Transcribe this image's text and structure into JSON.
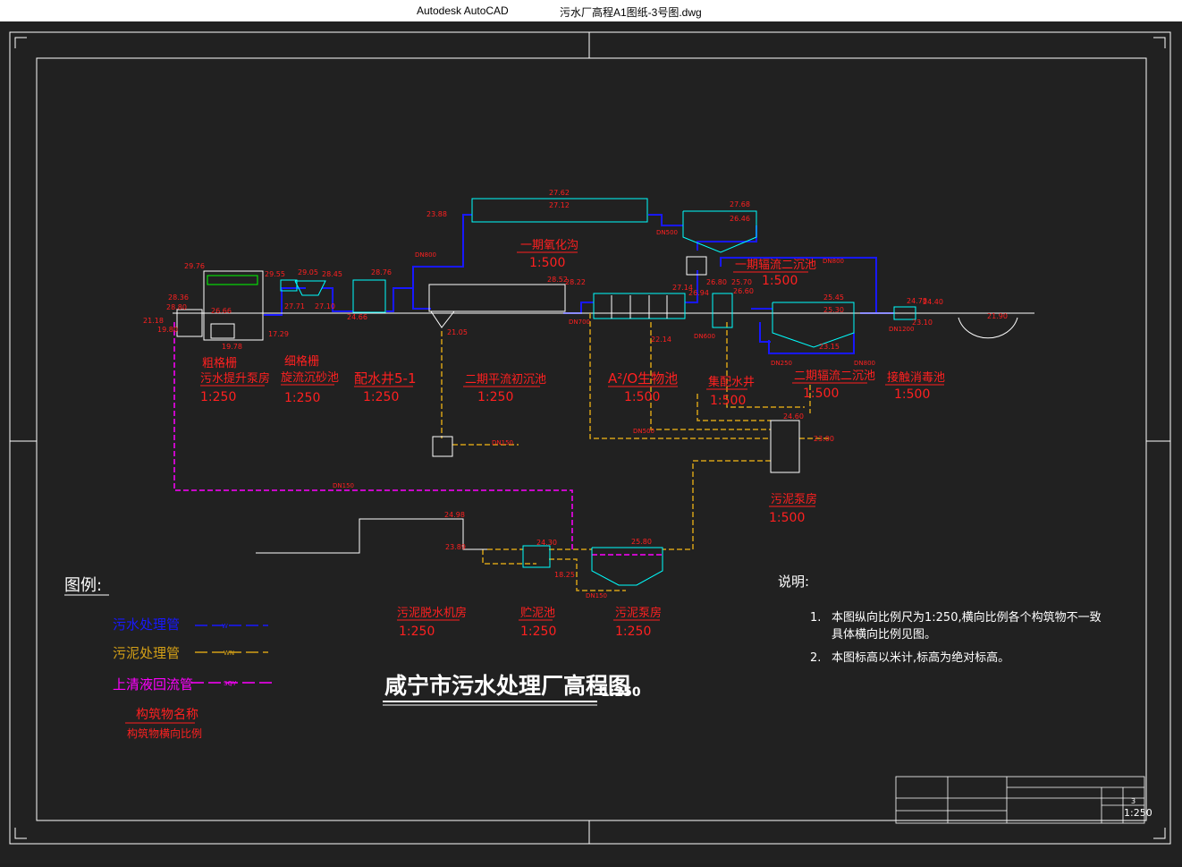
{
  "window": {
    "app_name": "Autodesk AutoCAD",
    "file_name": "污水厂高程A1图纸-3号图.dwg"
  },
  "colors": {
    "background": "#212121",
    "frame": "#ffffff",
    "water_pipe": "#1818ff",
    "sludge_pipe": "#d4a017",
    "return_pipe": "#ff00ff",
    "annotation": "#ff2020",
    "structure": "#00ffff"
  },
  "structures": {
    "s1": {
      "name": "粗格栅",
      "name2": "污水提升泵房",
      "scale": "1:250"
    },
    "s2": {
      "name": "细格栅",
      "name2": "旋流沉砂池",
      "scale": "1:250"
    },
    "s3": {
      "name": "配水井5-1",
      "scale": "1:250"
    },
    "s4": {
      "name": "二期平流初沉池",
      "scale": "1:250"
    },
    "s5": {
      "name": "A²/O生物池",
      "scale": "1:500"
    },
    "s6": {
      "name": "集配水井",
      "scale": "1:500"
    },
    "s7": {
      "name": "二期辐流二沉池",
      "scale": "1:500"
    },
    "s8": {
      "name": "接触消毒池",
      "scale": "1:500"
    },
    "s9": {
      "name": "一期氧化沟",
      "scale": "1:500"
    },
    "s10": {
      "name": "一期辐流二沉池",
      "scale": "1:500"
    },
    "s11": {
      "name": "污泥泵房",
      "scale": "1:500"
    },
    "s12": {
      "name": "污泥脱水机房",
      "scale": "1:250"
    },
    "s13": {
      "name": "贮泥池",
      "scale": "1:250"
    },
    "s14": {
      "name": "污泥泵房",
      "scale": "1:250"
    }
  },
  "elevations": {
    "e_27_62": "27.62",
    "e_27_12": "27.12",
    "e_27_68": "27.68",
    "e_26_46": "26.46",
    "e_23_88": "23.88",
    "e_29_76": "29.76",
    "e_29_55": "29.55",
    "e_29_05": "29.05",
    "e_28_45": "28.45",
    "e_28_76": "28.76",
    "e_28_36": "28.36",
    "e_28_80": "28.80",
    "e_27_71": "27.71",
    "e_27_10": "27.10",
    "e_26_66": "26.66",
    "e_24_66": "24.66",
    "e_21_18": "21.18",
    "e_19_80": "19.80",
    "e_17_29": "17.29",
    "e_19_78": "19.78",
    "e_21_05": "21.05",
    "e_28_52": "28.52",
    "e_28_22": "28.22",
    "e_27_14": "27.14",
    "e_26_94": "26.94",
    "e_26_80": "26.80",
    "e_25_70": "25.70",
    "e_26_60": "26.60",
    "e_25_45": "25.45",
    "e_25_30": "25.30",
    "e_24_78": "24.78",
    "e_24_40": "24.40",
    "e_22_14": "22.14",
    "e_23_15": "23.15",
    "e_23_10": "23.10",
    "e_21_90": "21.90",
    "e_24_60": "24.60",
    "e_24_98": "24.98",
    "e_23_00": "23.00",
    "e_23_89": "23.89",
    "e_24_30": "24.30",
    "e_18_25": "18.25",
    "e_25_80": "25.80"
  },
  "pipe_labels": {
    "dn800_a": "DN800",
    "dn500_a": "DN500",
    "dn800_b": "DN800",
    "dn1200": "DN1200",
    "dn700": "DN700",
    "dn600": "DN600",
    "dn150_a": "DN150",
    "dn500_b": "DN500",
    "dn150_b": "DN150",
    "dn250": "DN250",
    "dn800_c": "DN800",
    "dn150_c": "DN150"
  },
  "legend": {
    "title": "图例:",
    "water_pipe": "污水处理管",
    "water_code": "W",
    "sludge_pipe": "污泥处理管",
    "sludge_code": "WN",
    "return_pipe": "上清液回流管",
    "return_code": "SQY",
    "struct_name": "构筑物名称",
    "struct_scale": "构筑物横向比例"
  },
  "notes": {
    "title": "说明:",
    "item1_num": "1.",
    "item1_line1": "本图纵向比例尺为1:250,横向比例各个构筑物不一致",
    "item1_line2": "具体横向比例见图。",
    "item2_num": "2.",
    "item2_text": "本图标高以米计,标高为绝对标高。"
  },
  "main_title": {
    "text": "咸宁市污水处理厂高程图",
    "scale": "1:250"
  },
  "title_block": {
    "sheet_no": "3",
    "scale": "1:250"
  }
}
